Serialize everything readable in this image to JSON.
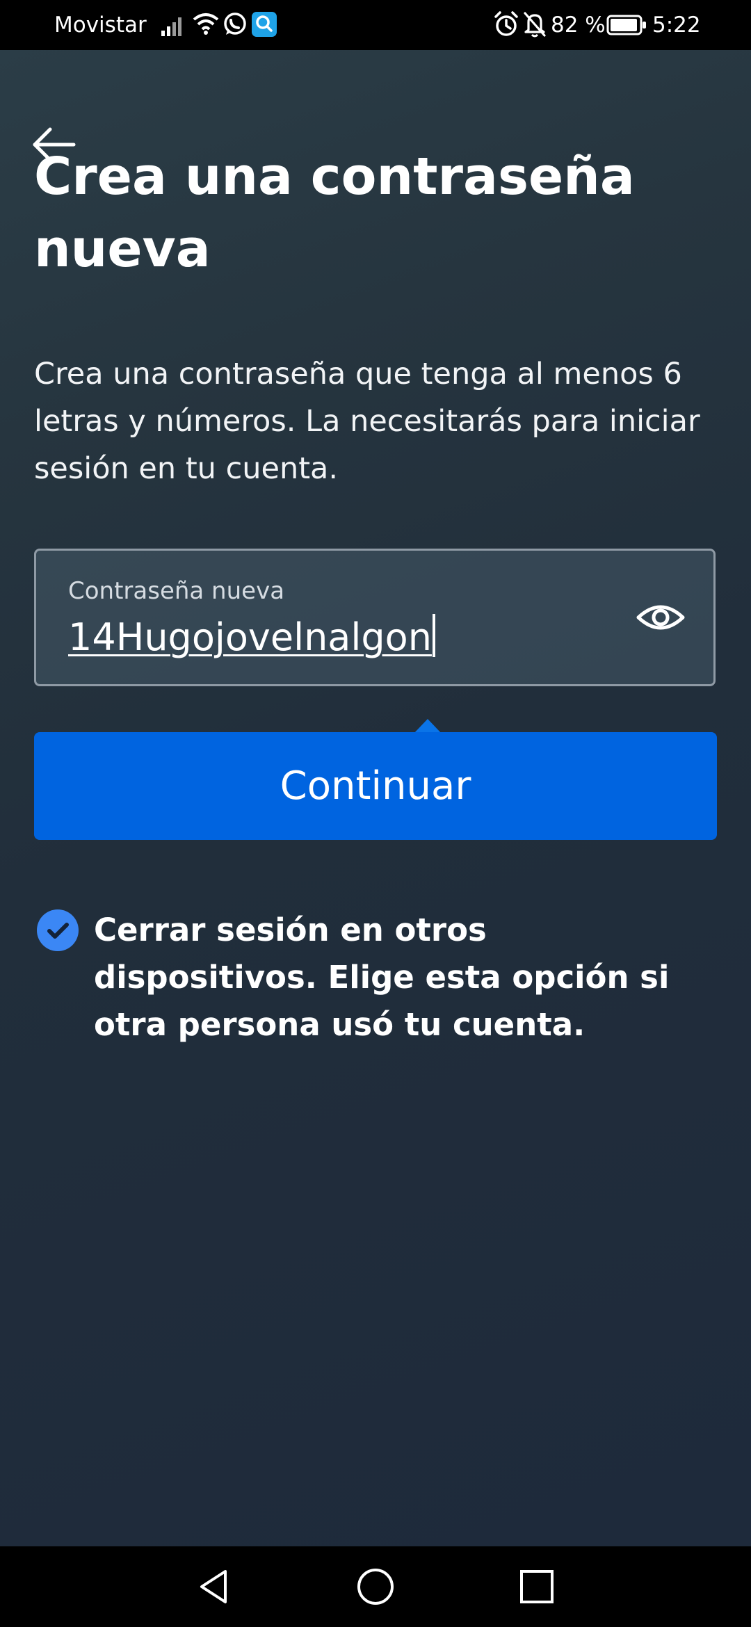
{
  "status_bar": {
    "carrier": "Movistar",
    "battery_percent": "82 %",
    "time": "5:22",
    "icons": [
      "signal-icon",
      "wifi-icon",
      "whatsapp-icon",
      "search-app-icon",
      "alarm-icon",
      "notifications-off-icon",
      "battery-icon"
    ]
  },
  "header": {
    "back_icon": "arrow-left-icon",
    "title": "Crea una contraseña nueva",
    "subtitle": "Crea una contraseña que tenga al menos 6 letras y números. La necesitarás para iniciar sesión en tu cuenta."
  },
  "password_field": {
    "label": "Contraseña nueva",
    "value": "14Hugojovelnalgon",
    "visibility_icon": "eye-icon"
  },
  "continue_button": {
    "label": "Continuar"
  },
  "logout_option": {
    "checked": true,
    "text": "Cerrar sesión en otros dispositivos. Elige esta opción si otra persona usó tu cuenta."
  },
  "nav_bar": {
    "icons": [
      "back-triangle-icon",
      "home-circle-icon",
      "recents-square-icon"
    ]
  },
  "colors": {
    "accent": "#0064e0",
    "checkbox": "#3b87f5",
    "background": "#1e2a3a",
    "status_bar": "#000000"
  }
}
